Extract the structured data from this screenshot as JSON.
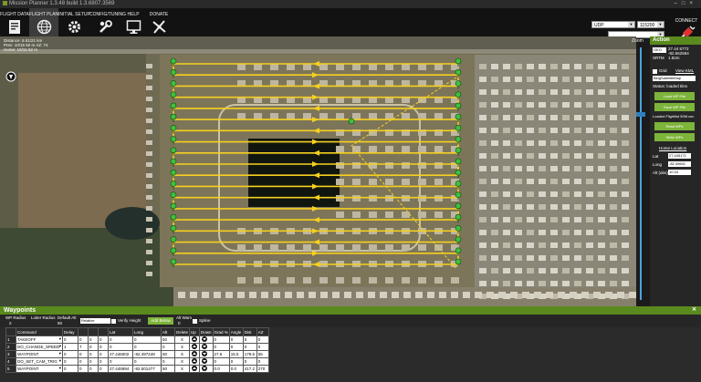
{
  "titlebar": {
    "text": "Mission Planner 1.3.48 build 1.3.6807.3569"
  },
  "menu": [
    {
      "label": "FLIGHT DATA"
    },
    {
      "label": "FLIGHT PLAN"
    },
    {
      "label": "INITIAL SETUP"
    },
    {
      "label": "CONFIG/TUNING"
    },
    {
      "label": "HELP"
    },
    {
      "label": "DONATE"
    }
  ],
  "connection": {
    "port": "UDP",
    "baud": "115200",
    "label": "CONNECT"
  },
  "map": {
    "distance": "Distance: 6.51/21 km",
    "prev": "Prev: 10/15 50 m AZ: 74",
    "home": "Home: 10/15 52 m"
  },
  "zoom": {
    "label": "Zoom"
  },
  "action": {
    "title": "Action",
    "frame": "GEO",
    "coords_lat": "27.44 5772",
    "coords_lng": "-82.562584",
    "srtm": "SRTM",
    "srtm_val": "1.82m",
    "grid_label": "Grid",
    "view_kml": "View KML",
    "map_type": "BingSatelliteMap",
    "status": "Status: loaded tiles",
    "load_wp": "Load WP File",
    "save_wp": "Save WP File",
    "loaded": "Loaded Flightlist 50M.csv",
    "read_wps": "Read WPs",
    "write_wps": "Write WPs",
    "home_location": "Home Location",
    "lat_label": "Lat",
    "lat_val": "27.445171",
    "long_label": "Long",
    "long_val": "-82.49601",
    "alt_label": "Alt (abs)",
    "alt_val": "10.34"
  },
  "waypoints": {
    "title": "Waypoints",
    "wp_radius_label": "WP Radius",
    "wp_radius": "2",
    "loiter_radius_label": "Loiter Radius",
    "default_alt_label": "Default Alt",
    "default_alt": "50",
    "alt_frame": "Relative",
    "verify_height": "Verify Height",
    "add_below": "Add Below",
    "alt_warn_label": "Alt Warn",
    "alt_warn": "0",
    "spline": "Spline",
    "columns": [
      "",
      "Command",
      "Delay",
      "",
      "",
      "",
      "Lat",
      "Long",
      "Alt",
      "Delete",
      "Up",
      "Down",
      "Grad %",
      "Angle",
      "Dist",
      "AZ"
    ],
    "rows": [
      {
        "n": "1",
        "cmd": "TAKEOFF",
        "p1": "0",
        "p2": "0",
        "p3": "0",
        "p4": "0",
        "lat": "0",
        "lng": "0",
        "alt": "50",
        "del": "X",
        "grad": "0",
        "angle": "0",
        "dist": "0",
        "az": "0"
      },
      {
        "n": "2",
        "cmd": "DO_CHANGE_SPEED",
        "p1": "1",
        "p2": "7",
        "p3": "0",
        "p4": "0",
        "lat": "0",
        "lng": "0",
        "alt": "0",
        "del": "X",
        "grad": "0",
        "angle": "0",
        "dist": "0",
        "az": "0"
      },
      {
        "n": "3",
        "cmd": "WAYPOINT",
        "p1": "0",
        "p2": "0",
        "p3": "0",
        "p4": "0",
        "lat": "27.446002",
        "lng": "-82.497249",
        "alt": "50",
        "del": "X",
        "grad": "27.6",
        "angle": "15.5",
        "dist": "179.6",
        "az": "55"
      },
      {
        "n": "4",
        "cmd": "DO_SET_CAM_TRIG",
        "p1": "0",
        "p2": "0",
        "p3": "0",
        "p4": "0",
        "lat": "0",
        "lng": "0",
        "alt": "0",
        "del": "X",
        "grad": "0",
        "angle": "0",
        "dist": "0",
        "az": "0"
      },
      {
        "n": "5",
        "cmd": "WAYPOINT",
        "p1": "0",
        "p2": "0",
        "p3": "0",
        "p4": "0",
        "lat": "27.445994",
        "lng": "-82.501477",
        "alt": "50",
        "del": "X",
        "grad": "0.0",
        "angle": "0.0",
        "dist": "417.2",
        "az": "270"
      }
    ]
  }
}
